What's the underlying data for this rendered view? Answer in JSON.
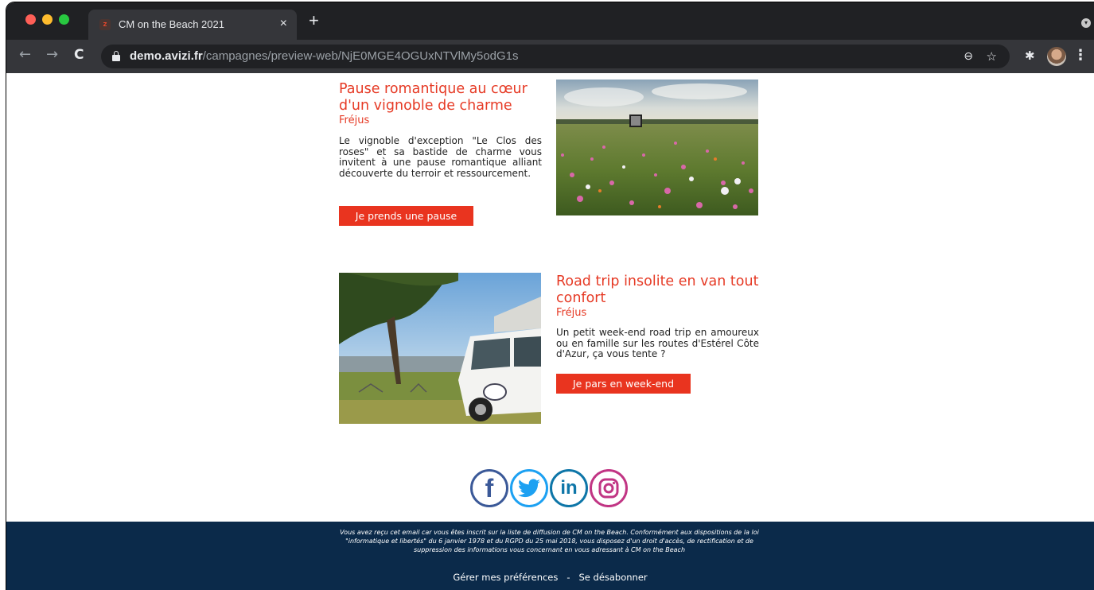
{
  "browser": {
    "tab_title": "CM on the Beach 2021",
    "tab_favicon_text": "z",
    "tab_close": "×",
    "new_tab": "+",
    "url_host": "demo.avizi.fr",
    "url_path": "/campagnes/preview-web/NjE0MGE4OGUxNTVlMy5odG1s",
    "back": "←",
    "forward": "→",
    "reload": "C",
    "zoom": "⊖",
    "star": "☆",
    "extensions": "✱",
    "menu": "⋮"
  },
  "articles": [
    {
      "title": "Pause romantique au cœur d'un vignoble de charme",
      "city": "Fréjus",
      "text": "Le vignoble d'exception \"Le Clos des roses\" et sa bastide de charme vous invitent à une pause romantique alliant découverte du terroir et ressourcement.",
      "cta": "Je prends une pause",
      "image": "flower-field-photo"
    },
    {
      "title": "Road trip insolite en van tout confort",
      "city": "Fréjus",
      "text": "Un petit week-end road trip en amoureux ou en famille sur les routes d'Estérel Côte d'Azur, ça vous tente ?",
      "cta": "Je pars en week-end",
      "image": "campervan-photo"
    }
  ],
  "social": {
    "facebook": "f",
    "twitter": "twitter-bird-icon",
    "linkedin": "in",
    "instagram": "instagram-camera-icon"
  },
  "footer": {
    "legal": "Vous avez reçu cet email car vous êtes inscrit sur la liste de diffusion de CM on the Beach. Conformément aux dispositions de la loi \"informatique et libertés\" du 6 janvier 1978 et du RGPD du 25 mai 2018, vous disposez d'un droit d'accès, de rectification et de suppression des informations vous concernant en vous adressant à CM on the Beach",
    "manage_prefs": "Gérer mes préférences",
    "separator": "-",
    "unsubscribe": "Se désabonner"
  },
  "colors": {
    "accent": "#e9341f",
    "footer_bg": "#0b2a4a",
    "chrome_dark": "#202124"
  }
}
